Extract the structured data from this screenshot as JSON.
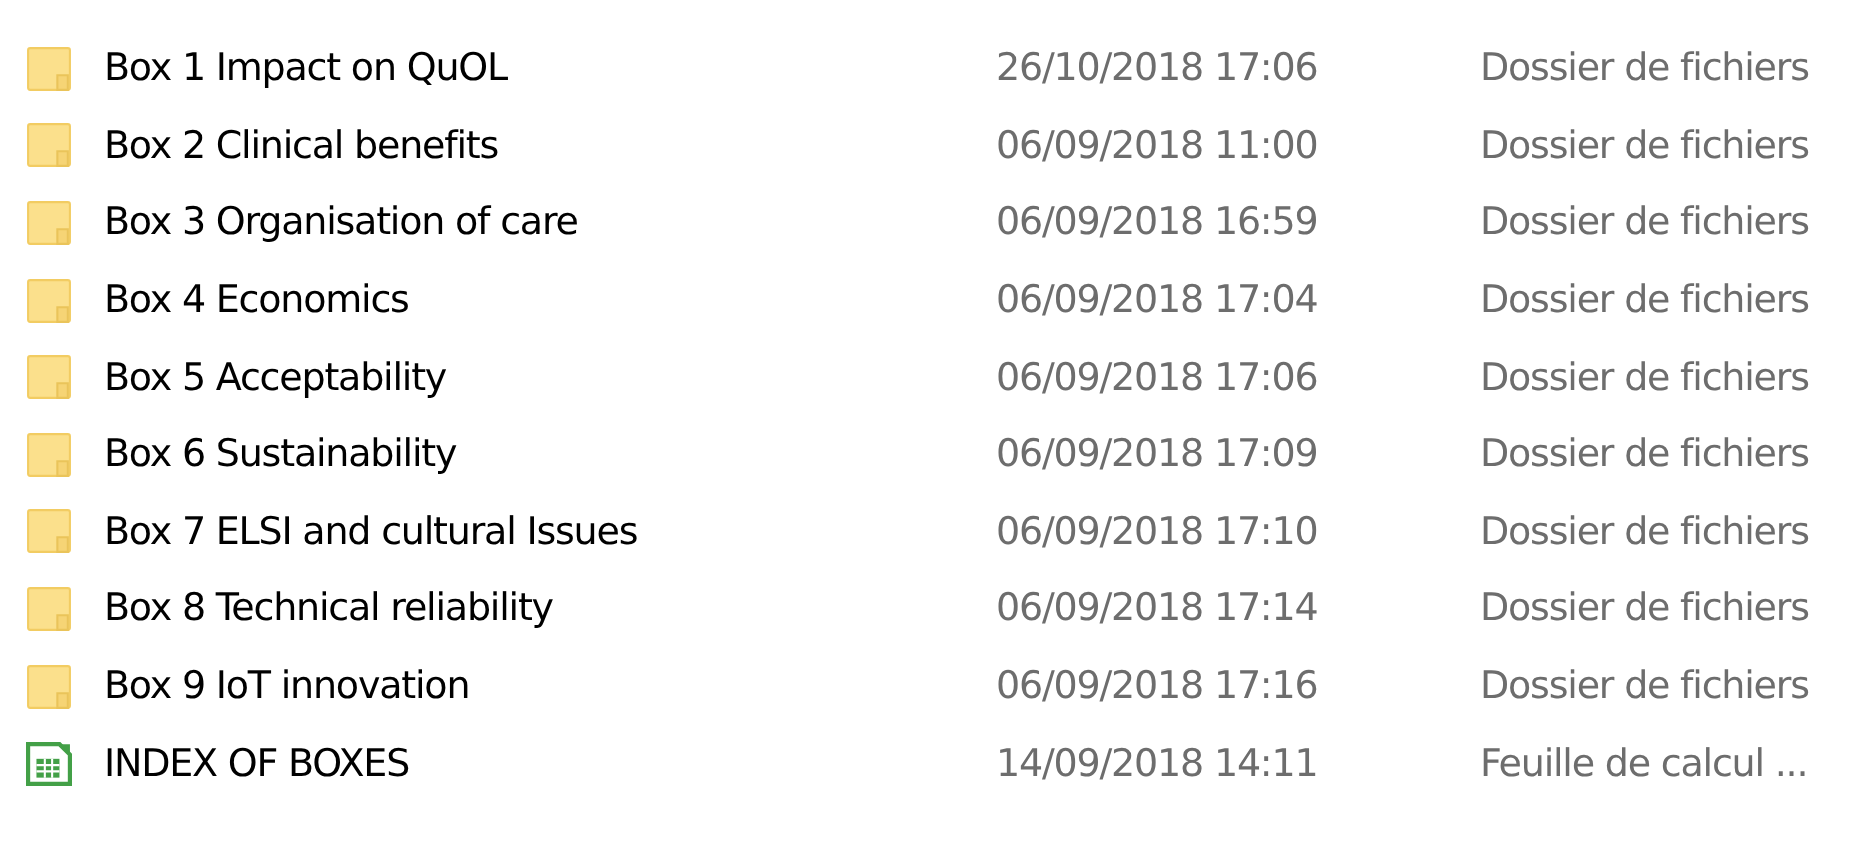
{
  "files": [
    {
      "kind": "folder",
      "name": "Box 1 Impact on QuOL",
      "modified": "26/10/2018 17:06",
      "type": "Dossier de fichiers"
    },
    {
      "kind": "folder",
      "name": "Box 2 Clinical benefits",
      "modified": "06/09/2018 11:00",
      "type": "Dossier de fichiers"
    },
    {
      "kind": "folder",
      "name": "Box 3 Organisation of care",
      "modified": "06/09/2018 16:59",
      "type": "Dossier de fichiers"
    },
    {
      "kind": "folder",
      "name": "Box 4 Economics",
      "modified": "06/09/2018 17:04",
      "type": "Dossier de fichiers"
    },
    {
      "kind": "folder",
      "name": "Box 5 Acceptability",
      "modified": "06/09/2018 17:06",
      "type": "Dossier de fichiers"
    },
    {
      "kind": "folder",
      "name": "Box 6 Sustainability",
      "modified": "06/09/2018 17:09",
      "type": "Dossier de fichiers"
    },
    {
      "kind": "folder",
      "name": "Box 7 ELSI and cultural Issues",
      "modified": "06/09/2018 17:10",
      "type": "Dossier de fichiers"
    },
    {
      "kind": "folder",
      "name": "Box 8 Technical reliability",
      "modified": "06/09/2018 17:14",
      "type": "Dossier de fichiers"
    },
    {
      "kind": "folder",
      "name": "Box 9 IoT innovation",
      "modified": "06/09/2018 17:16",
      "type": "Dossier de fichiers"
    },
    {
      "kind": "spreadsheet",
      "name": "INDEX OF BOXES",
      "modified": "14/09/2018 14:11",
      "type": "Feuille de calcul ..."
    }
  ]
}
